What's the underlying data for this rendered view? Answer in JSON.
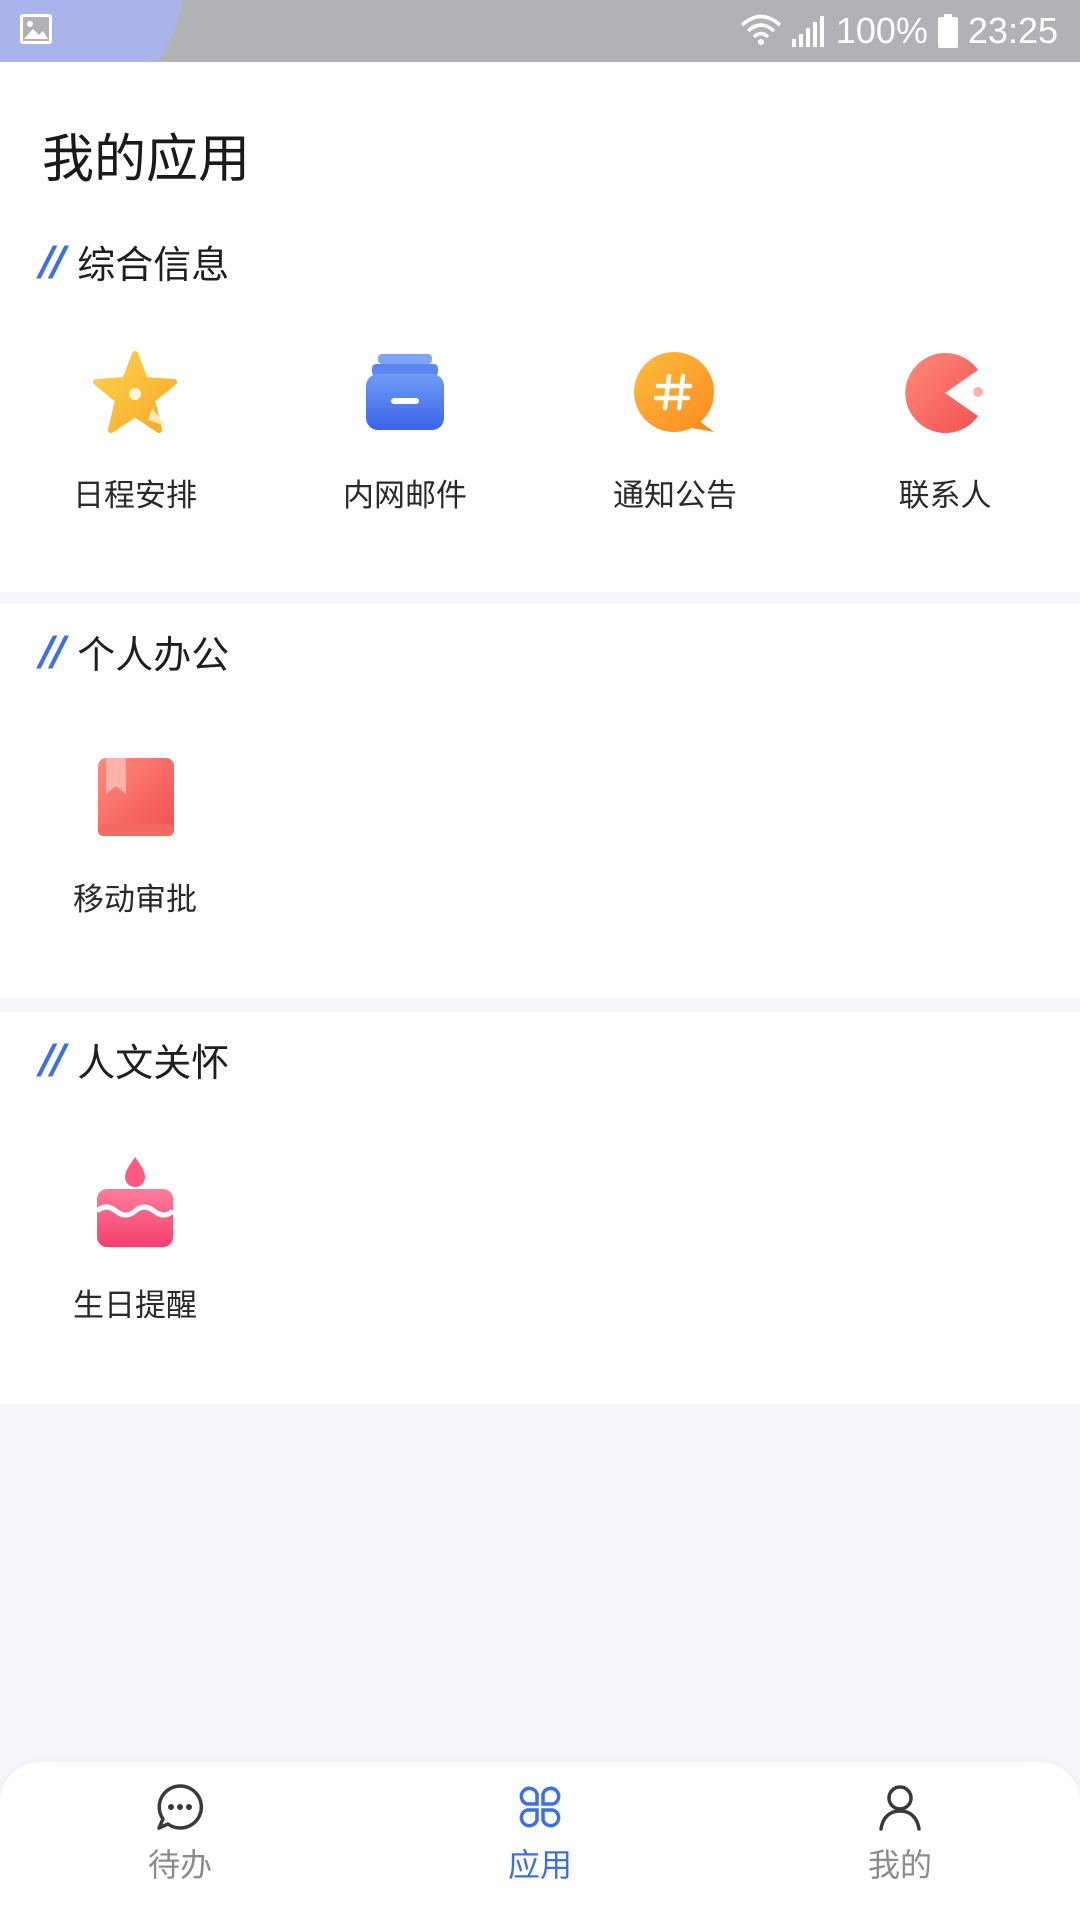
{
  "status_bar": {
    "battery": "100%",
    "time": "23:25"
  },
  "header": {
    "title": "我的应用"
  },
  "sections": [
    {
      "title": "综合信息",
      "apps": [
        {
          "label": "日程安排",
          "icon": "star-icon"
        },
        {
          "label": "内网邮件",
          "icon": "mail-tray-icon"
        },
        {
          "label": "通知公告",
          "icon": "hash-bubble-icon"
        },
        {
          "label": "联系人",
          "icon": "contact-icon"
        }
      ]
    },
    {
      "title": "个人办公",
      "apps": [
        {
          "label": "移动审批",
          "icon": "book-icon"
        }
      ]
    },
    {
      "title": "人文关怀",
      "apps": [
        {
          "label": "生日提醒",
          "icon": "cake-icon"
        }
      ]
    }
  ],
  "bottom_nav": [
    {
      "label": "待办",
      "icon": "chat-bubble-icon",
      "active": false
    },
    {
      "label": "应用",
      "icon": "apps-grid-icon",
      "active": true
    },
    {
      "label": "我的",
      "icon": "person-icon",
      "active": false
    }
  ],
  "colors": {
    "accent": "#3d6fe6",
    "inactive": "#8c8c8c"
  }
}
